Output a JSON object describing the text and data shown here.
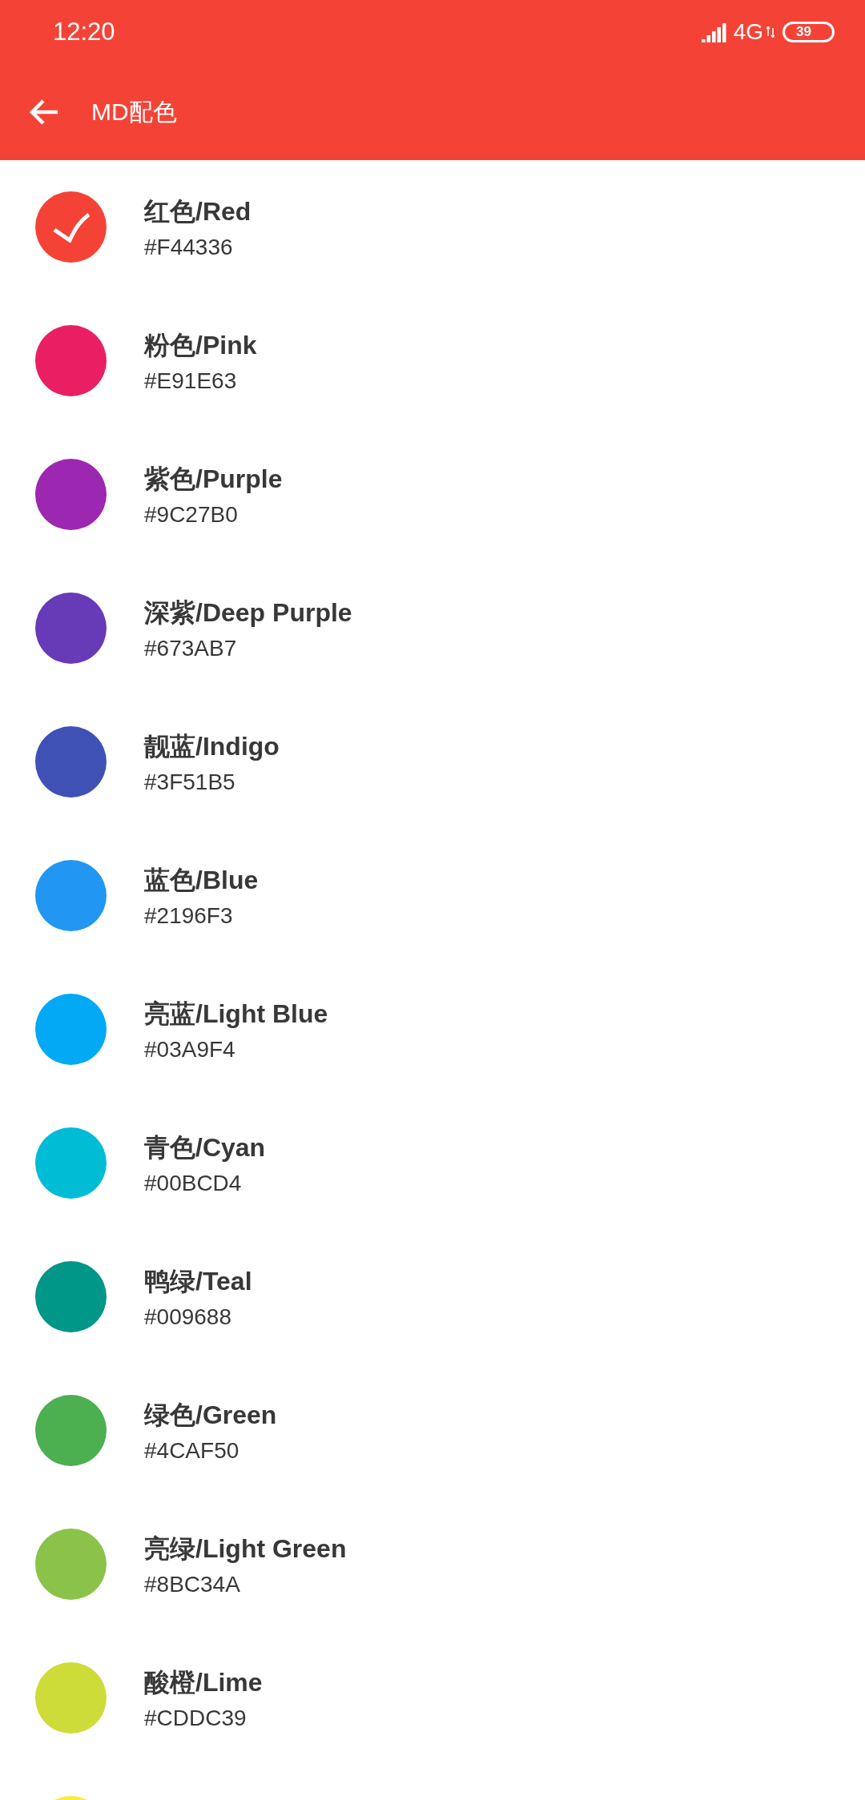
{
  "status_bar": {
    "time": "12:20",
    "network": "4G",
    "battery": "39"
  },
  "app_bar": {
    "title": "MD配色"
  },
  "colors": [
    {
      "name": "红色/Red",
      "hex": "#F44336",
      "color": "#f44336",
      "selected": true
    },
    {
      "name": "粉色/Pink",
      "hex": "#E91E63",
      "color": "#e91e63",
      "selected": false
    },
    {
      "name": "紫色/Purple",
      "hex": "#9C27B0",
      "color": "#9c27b0",
      "selected": false
    },
    {
      "name": "深紫/Deep Purple",
      "hex": "#673AB7",
      "color": "#673ab7",
      "selected": false
    },
    {
      "name": "靓蓝/Indigo",
      "hex": "#3F51B5",
      "color": "#3f51b5",
      "selected": false
    },
    {
      "name": "蓝色/Blue",
      "hex": "#2196F3",
      "color": "#2196f3",
      "selected": false
    },
    {
      "name": "亮蓝/Light Blue",
      "hex": "#03A9F4",
      "color": "#03a9f4",
      "selected": false
    },
    {
      "name": "青色/Cyan",
      "hex": "#00BCD4",
      "color": "#00bcd4",
      "selected": false
    },
    {
      "name": "鸭绿/Teal",
      "hex": "#009688",
      "color": "#009688",
      "selected": false
    },
    {
      "name": "绿色/Green",
      "hex": "#4CAF50",
      "color": "#4caf50",
      "selected": false
    },
    {
      "name": "亮绿/Light Green",
      "hex": "#8BC34A",
      "color": "#8bc34a",
      "selected": false
    },
    {
      "name": "酸橙/Lime",
      "hex": "#CDDC39",
      "color": "#cddc39",
      "selected": false
    },
    {
      "color": "#ffeb3b"
    }
  ]
}
